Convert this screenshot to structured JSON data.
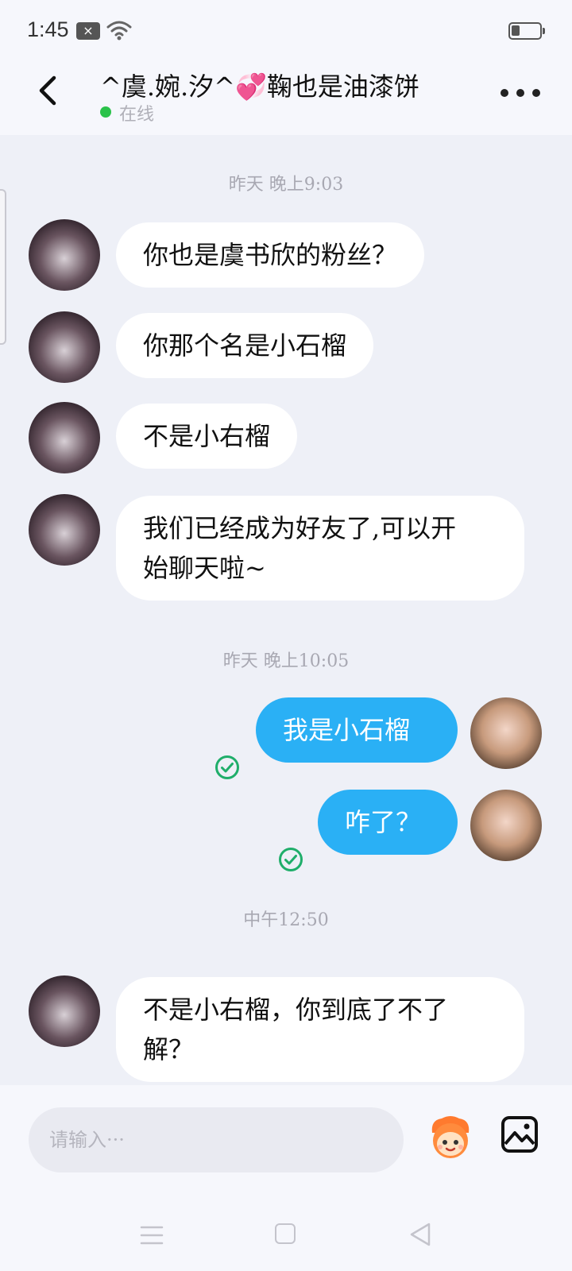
{
  "status_bar": {
    "time": "1:45",
    "notification_glyph": "×"
  },
  "header": {
    "title": "^虞.婉.汐^💞鞠也是油漆饼",
    "status": "在线",
    "status_color": "#2bc24a"
  },
  "messages": [
    {
      "type": "time",
      "text": "昨天 晚上9:03"
    },
    {
      "type": "received",
      "text": "你也是虞书欣的粉丝？"
    },
    {
      "type": "received",
      "text": "你那个名是小石榴"
    },
    {
      "type": "received",
      "text": "不是小右榴"
    },
    {
      "type": "received",
      "text_line1": "我们已经成为好友了,可以开",
      "text_line2": "始聊天啦~"
    },
    {
      "type": "time",
      "text": "昨天 晚上10:05"
    },
    {
      "type": "sent",
      "text": "我是小石榴",
      "read": true
    },
    {
      "type": "sent",
      "text": "咋了？",
      "read": true
    },
    {
      "type": "time",
      "text": "中午12:50"
    },
    {
      "type": "received",
      "text_line1": "不是小右榴，你到底了不了",
      "text_line2": "解？"
    }
  ],
  "input": {
    "placeholder": "请输入···"
  },
  "icons": {
    "back": "back-arrow-icon",
    "more": "more-dots-icon",
    "emoji": "emoji-face-icon",
    "image": "image-icon",
    "read": "check-circle-icon"
  },
  "colors": {
    "sent_bubble": "#2ab0f5",
    "received_bubble": "#ffffff",
    "read_check": "#1fae6a"
  }
}
